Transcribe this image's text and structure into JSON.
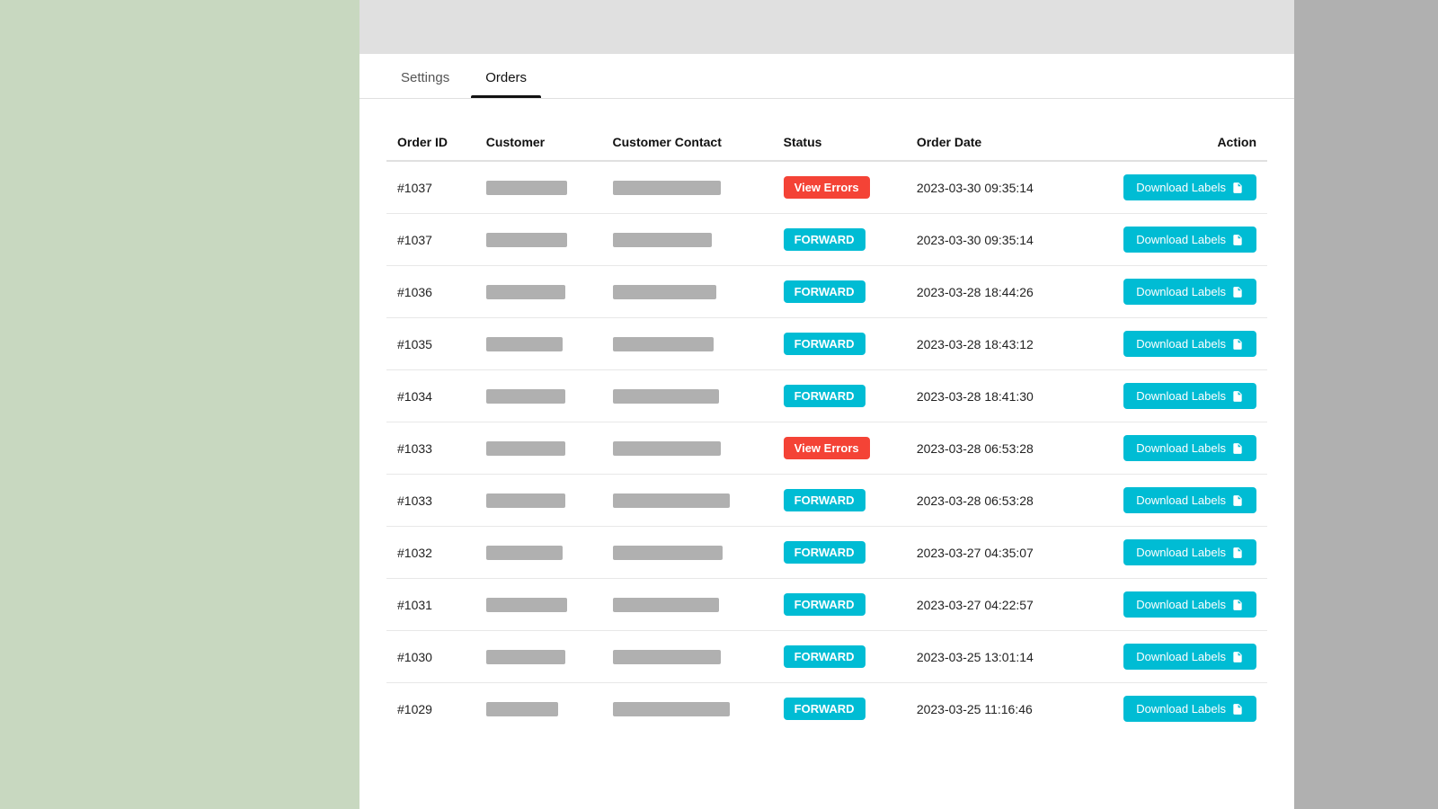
{
  "tabs": [
    {
      "label": "Settings",
      "active": false
    },
    {
      "label": "Orders",
      "active": true
    }
  ],
  "table": {
    "headers": [
      "Order ID",
      "Customer",
      "Customer Contact",
      "Status",
      "Order Date",
      "Action"
    ],
    "download_label": "Download Labels",
    "rows": [
      {
        "order_id": "#1037",
        "customer_width": 90,
        "contact_width": 120,
        "status": "View Errors",
        "status_type": "error",
        "order_date": "2023-03-30 09:35:14"
      },
      {
        "order_id": "#1037",
        "customer_width": 90,
        "contact_width": 110,
        "status": "FORWARD",
        "status_type": "forward",
        "order_date": "2023-03-30 09:35:14"
      },
      {
        "order_id": "#1036",
        "customer_width": 88,
        "contact_width": 115,
        "status": "FORWARD",
        "status_type": "forward",
        "order_date": "2023-03-28 18:44:26"
      },
      {
        "order_id": "#1035",
        "customer_width": 85,
        "contact_width": 112,
        "status": "FORWARD",
        "status_type": "forward",
        "order_date": "2023-03-28 18:43:12"
      },
      {
        "order_id": "#1034",
        "customer_width": 88,
        "contact_width": 118,
        "status": "FORWARD",
        "status_type": "forward",
        "order_date": "2023-03-28 18:41:30"
      },
      {
        "order_id": "#1033",
        "customer_width": 88,
        "contact_width": 120,
        "status": "View Errors",
        "status_type": "error",
        "order_date": "2023-03-28 06:53:28"
      },
      {
        "order_id": "#1033",
        "customer_width": 88,
        "contact_width": 130,
        "status": "FORWARD",
        "status_type": "forward",
        "order_date": "2023-03-28 06:53:28"
      },
      {
        "order_id": "#1032",
        "customer_width": 85,
        "contact_width": 122,
        "status": "FORWARD",
        "status_type": "forward",
        "order_date": "2023-03-27 04:35:07"
      },
      {
        "order_id": "#1031",
        "customer_width": 90,
        "contact_width": 118,
        "status": "FORWARD",
        "status_type": "forward",
        "order_date": "2023-03-27 04:22:57"
      },
      {
        "order_id": "#1030",
        "customer_width": 88,
        "contact_width": 120,
        "status": "FORWARD",
        "status_type": "forward",
        "order_date": "2023-03-25 13:01:14"
      },
      {
        "order_id": "#1029",
        "customer_width": 80,
        "contact_width": 130,
        "status": "FORWARD",
        "status_type": "forward",
        "order_date": "2023-03-25 11:16:46"
      }
    ]
  }
}
